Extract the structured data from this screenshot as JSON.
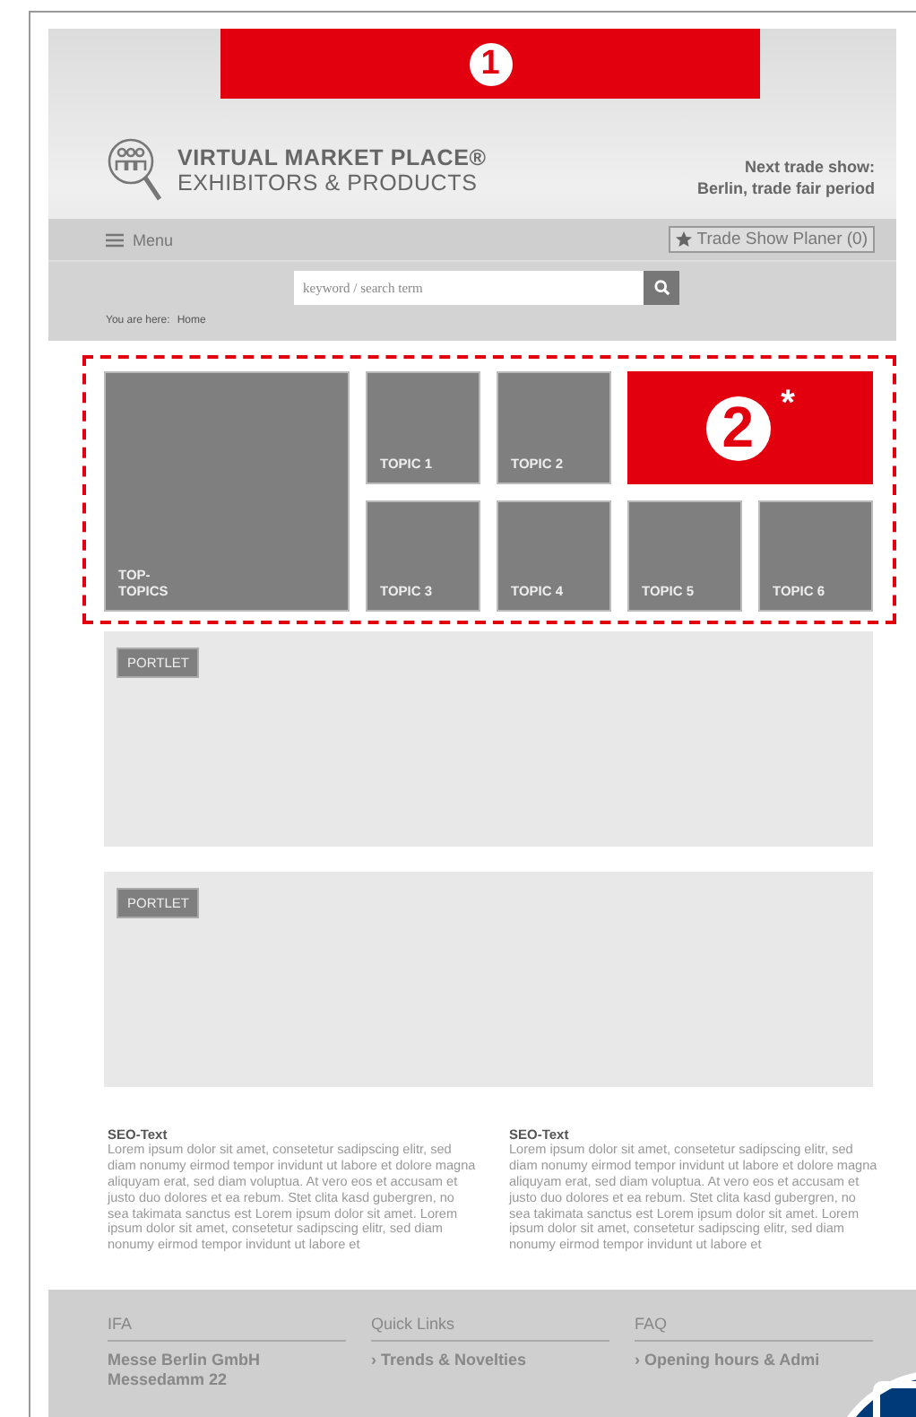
{
  "banner": {
    "marker": "1"
  },
  "logo": {
    "title": "VIRTUAL MARKET PLACE®",
    "subtitle": "EXHIBITORS & PRODUCTS"
  },
  "next_show": [
    "Next trade show:",
    "Berlin, trade fair period"
  ],
  "menu": {
    "label": "Menu"
  },
  "planer": {
    "label": "Trade Show Planer (0)"
  },
  "search": {
    "placeholder": "keyword / search term"
  },
  "breadcrumb": {
    "label": "You are here:",
    "current": "Home"
  },
  "tiles": [
    {
      "kind": "top",
      "label": "TOP-\nTOPICS"
    },
    {
      "kind": "topic",
      "label": "TOPIC 1"
    },
    {
      "kind": "topic",
      "label": "TOPIC 2"
    },
    {
      "kind": "marker",
      "number": "2",
      "note": "*"
    },
    {
      "kind": "topic",
      "label": "TOPIC 3"
    },
    {
      "kind": "topic",
      "label": "TOPIC 4"
    },
    {
      "kind": "topic",
      "label": "TOPIC 5"
    },
    {
      "kind": "topic",
      "label": "TOPIC 6"
    }
  ],
  "portlets": [
    {
      "label": "PORTLET"
    },
    {
      "label": "PORTLET"
    }
  ],
  "seo": [
    {
      "title": "SEO-Text",
      "text": "Lorem ipsum dolor sit amet, consetetur sadipscing elitr, sed diam nonumy eirmod tempor invidunt ut labore et dolore magna aliquyam erat, sed diam voluptua. At vero eos et accusam et justo duo dolores et ea rebum. Stet clita kasd gubergren, no sea takimata sanctus est Lorem ipsum dolor sit amet. Lorem ipsum dolor sit amet, consetetur sadipscing elitr, sed diam nonumy eirmod tempor invidunt ut labore et"
    },
    {
      "title": "SEO-Text",
      "text": "Lorem ipsum dolor sit amet, consetetur sadipscing elitr, sed diam nonumy eirmod tempor invidunt ut labore et dolore magna aliquyam erat, sed diam voluptua. At vero eos et accusam et justo duo dolores et ea rebum. Stet clita kasd gubergren, no sea takimata sanctus est Lorem ipsum dolor sit amet. Lorem ipsum dolor sit amet, consetetur sadipscing elitr, sed diam nonumy eirmod tempor invidunt ut labore et"
    }
  ],
  "footer": [
    {
      "heading": "IFA",
      "items": [
        {
          "kind": "text",
          "label": "Messe Berlin GmbH"
        },
        {
          "kind": "text",
          "label": "Messedamm 22"
        }
      ]
    },
    {
      "heading": "Quick Links",
      "items": [
        {
          "kind": "link",
          "label": "› Trends & Novelties"
        }
      ]
    },
    {
      "heading": "FAQ",
      "items": [
        {
          "kind": "link",
          "label": "› Opening hours & Admi"
        }
      ]
    }
  ]
}
